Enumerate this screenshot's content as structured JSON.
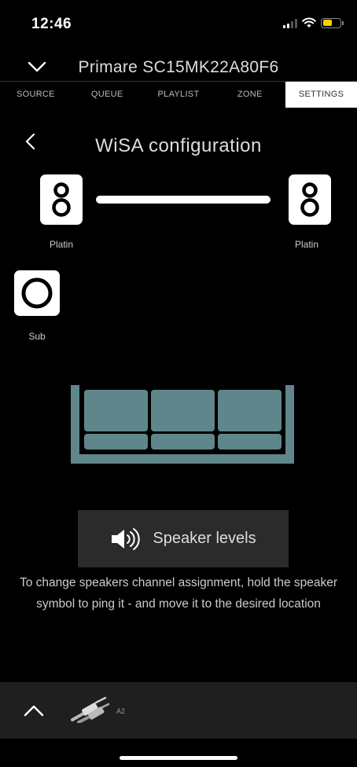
{
  "status": {
    "time": "12:46"
  },
  "header": {
    "device_name": "Primare SC15MK22A80F6"
  },
  "tabs": [
    {
      "label": "SOURCE",
      "active": false
    },
    {
      "label": "QUEUE",
      "active": false
    },
    {
      "label": "PLAYLIST",
      "active": false
    },
    {
      "label": "ZONE",
      "active": false
    },
    {
      "label": "SETTINGS",
      "active": true
    }
  ],
  "page": {
    "title": "WiSA configuration"
  },
  "speakers": {
    "left": {
      "label": "Platin"
    },
    "right": {
      "label": "Platin"
    },
    "sub": {
      "label": "Sub"
    }
  },
  "speaker_levels_button": {
    "label": "Speaker levels"
  },
  "instructions": "To change speakers channel assignment, hold the speaker symbol to ping it - and move it to the desired location",
  "bottom_bar": {
    "source_label": "A2"
  },
  "colors": {
    "sofa": "#5e868b",
    "tab_active_bg": "#ffffff",
    "button_bg": "#2b2b2b",
    "battery": "#f5d000"
  }
}
